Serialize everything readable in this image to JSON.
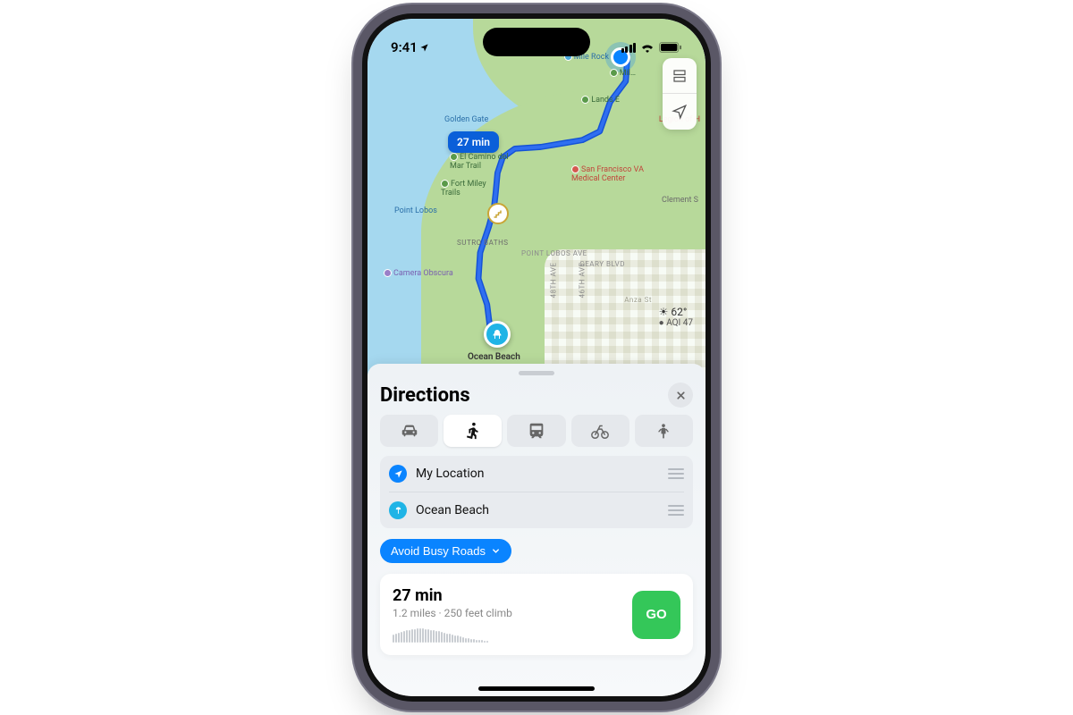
{
  "status": {
    "time": "9:41"
  },
  "map": {
    "route_badge": "27 min",
    "weather_temp": "62°",
    "weather_aqi": "AQI 47",
    "destination_label": "Ocean Beach",
    "pois": {
      "mile_rock": "Mile Rock",
      "mil": "Mil…",
      "lands_e": "Lands E",
      "legion": "Legion of H",
      "golden_gate": "Golden Gate",
      "el_camino": "El Camino del Mar Trail",
      "fort_miley": "Fort Miley Trails",
      "sf_va": "San Francisco VA Medical Center",
      "point_lobos": "Point Lobos",
      "sutro_baths": "SUTRO BATHS",
      "camera_obscura": "Camera Obscura",
      "clement": "Clement S",
      "geary": "GEARY BLVD",
      "anza": "Anza St",
      "point_lobos_ave": "POINT LOBOS AVE",
      "a48": "48TH AVE",
      "a46": "46TH AVE"
    }
  },
  "sheet": {
    "title": "Directions",
    "from": "My Location",
    "to": "Ocean Beach",
    "filter": "Avoid Busy Roads",
    "route_time": "27 min",
    "route_sub": "1.2 miles · 250 feet climb",
    "go": "GO"
  },
  "modes": [
    "drive",
    "walk",
    "transit",
    "cycle",
    "rideshare"
  ],
  "selected_mode": "walk"
}
